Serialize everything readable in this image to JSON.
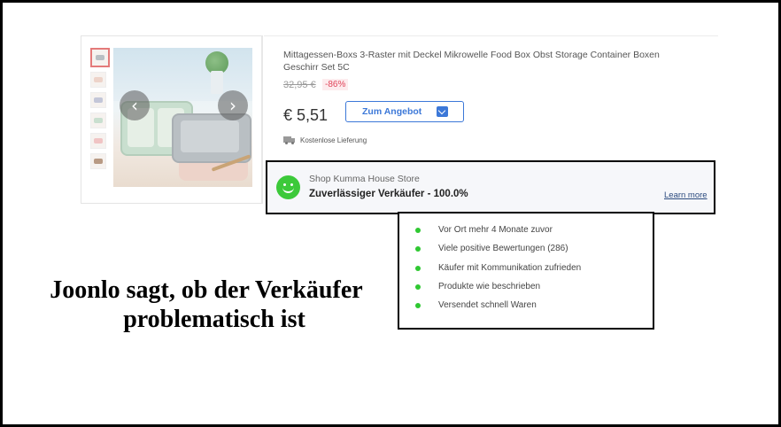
{
  "product": {
    "title": "Mittagessen-Boxs 3-Raster mit Deckel Mikrowelle Food Box Obst Storage Container Boxen Geschirr Set 5C",
    "old_price": "32,95 €",
    "discount": "-86%",
    "price": "€ 5,51",
    "offer_button": "Zum Angebot",
    "delivery": "Kostenlose Lieferung",
    "image_icon": "lunch-box-photo",
    "thumbnail_count": 6
  },
  "seller": {
    "shop": "Shop Kumma House Store",
    "rating": "Zuverlässiger Verkäufer - 100.0%",
    "learn_more": "Learn more",
    "status_color": "#3cc93a",
    "icon": "smiley-icon"
  },
  "features": [
    "Vor Ort mehr 4 Monate zuvor",
    "Viele positive Bewertungen (286)",
    "Käufer mit Kommunikation zufrieden",
    "Produkte wie beschrieben",
    "Versendet schnell Waren"
  ],
  "caption": {
    "line1": "Joonlo sagt, ob der Verkäufer",
    "line2": "problematisch ist"
  },
  "colors": {
    "accent": "#3c78d8",
    "discount": "#e0455a",
    "bullet": "#2fc832"
  }
}
